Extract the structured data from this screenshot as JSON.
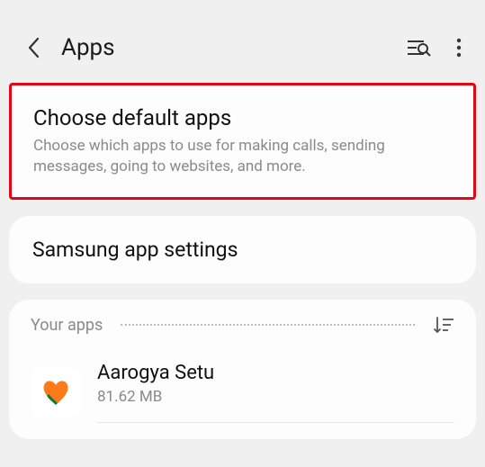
{
  "header": {
    "title": "Apps"
  },
  "default_apps": {
    "title": "Choose default apps",
    "description": "Choose which apps to use for making calls, sending messages, going to websites, and more."
  },
  "samsung_settings": {
    "title": "Samsung app settings"
  },
  "your_apps": {
    "label": "Your apps"
  },
  "apps": [
    {
      "name": "Aarogya Setu",
      "size": "81.62 MB"
    }
  ]
}
